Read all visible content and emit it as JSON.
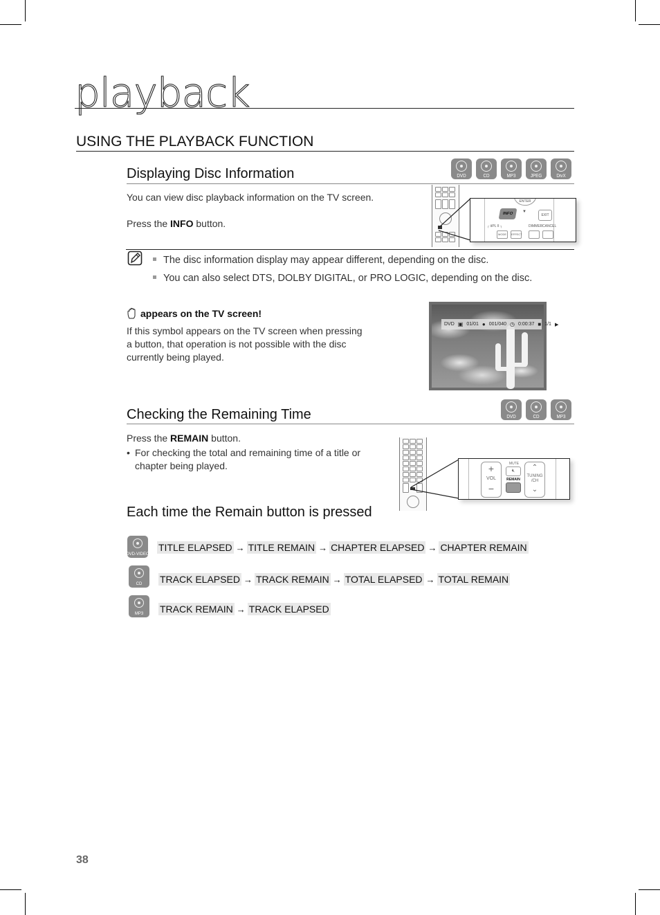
{
  "chapter": {
    "title": "playback"
  },
  "section": {
    "title": "USING THE PLAYBACK FUNCTION"
  },
  "disc_info": {
    "title": "Displaying Disc Information",
    "badges": [
      "DVD",
      "CD",
      "MP3",
      "JPEG",
      "DivX"
    ],
    "intro": "You can view disc playback information  on the TV screen.",
    "press_prefix": "Press the ",
    "press_button": "INFO",
    "press_suffix": " button.",
    "remote_callout": {
      "enter_label": "ENTER",
      "info_label": "INFO",
      "exit_label": "EXIT",
      "mode_label": "MODE",
      "effect_label": "EFFECT",
      "pl2_label": "┌ ⅡPL II ┐",
      "dimmer_label": "DIMMER",
      "cancel_label": "CANCEL"
    }
  },
  "notes": {
    "icon": "note-pencil-icon",
    "items": [
      "The disc information display may appear different, depending on the disc.",
      "You can also  select DTS, DOLBY DIGITAL, or PRO LOGIC, depending on the disc."
    ]
  },
  "hand_symbol": {
    "icon": "hand-stop-icon",
    "heading": "appears on the TV screen!",
    "body": "If this symbol appears on the TV screen when pressing a button, that operation is not possible with the disc currently being played."
  },
  "tv_osd": {
    "disc_type": "DVD",
    "title": "01/01",
    "chapter": "001/040",
    "time": "0:00:37",
    "angle": "1/1",
    "play_icon": "▶"
  },
  "remaining_time": {
    "title": "Checking the Remaining Time",
    "badges": [
      "DVD",
      "CD",
      "MP3"
    ],
    "press_prefix": "Press the ",
    "press_button": "REMAIN",
    "press_suffix": " button.",
    "bullet": "For checking the total and remaining time of a title or chapter being played.",
    "remote_callout": {
      "vol_label": "VOL",
      "mute_label": "MUTE",
      "remain_label": "REMAIN",
      "tuning_label": "TUNING /CH"
    }
  },
  "remain_sequence": {
    "title": "Each time the Remain button is pressed",
    "rows": [
      {
        "disc": "DVD-VIDEO",
        "steps": [
          "TITLE ELAPSED",
          "TITLE REMAIN",
          "CHAPTER ELAPSED",
          "CHAPTER REMAIN"
        ]
      },
      {
        "disc": "CD",
        "steps": [
          "TRACK ELAPSED",
          "TRACK REMAIN",
          "TOTAL ELAPSED",
          "TOTAL REMAIN"
        ]
      },
      {
        "disc": "MP3",
        "steps": [
          "TRACK REMAIN",
          "TRACK ELAPSED"
        ]
      }
    ],
    "arrow": "→"
  },
  "footer": {
    "page_number": "38"
  }
}
